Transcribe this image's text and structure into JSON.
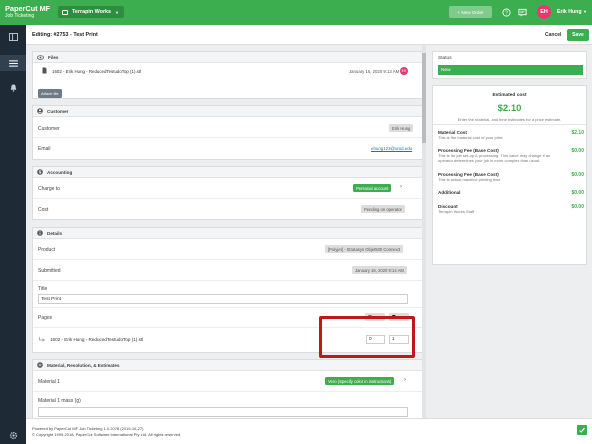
{
  "topbar": {
    "brand_title": "PaperCut MF",
    "brand_sub": "Job Ticketing",
    "org_name": "Terrapin Works",
    "new_order_label": "+ New Order",
    "user_initials": "EH",
    "user_name": "Erik Hung",
    "accent": "#3dae4f"
  },
  "editing": {
    "title": "Editing: #2753  -  Test Print",
    "cancel_label": "Cancel",
    "save_label": "Save"
  },
  "files": {
    "heading": "Files",
    "file_name": "1602 - Erik Hung - ReducedTestudoTop (1).stl",
    "file_date": "January 16, 2020 9:13 AM",
    "file_avatar": "EH",
    "attach_label": "Attach file"
  },
  "customer": {
    "heading": "Customer",
    "customer_label": "Customer",
    "customer_value": "Erik Hung",
    "email_label": "Email",
    "email_value": "ehung123@umd.edu"
  },
  "accounting": {
    "heading": "Accounting",
    "charge_label": "Charge to",
    "charge_value": "Personal account",
    "cost_label": "Cost",
    "cost_value": "Pending on operator"
  },
  "details": {
    "heading": "Details",
    "product_label": "Product",
    "product_value": "[Polyjet] - Stratasys Objet500 Connex3",
    "submitted_label": "Submitted",
    "submitted_value": "January 16, 2020 9:14 AM",
    "title_label": "Title",
    "title_value": "Test Print",
    "pages_label": "Pages",
    "pages_count_a": "0",
    "pages_count_b": "1",
    "file_row_name": "1602 - Erik Hung - ReducedTestudoTop (1).stl",
    "file_row_a": "0",
    "file_row_b": "1"
  },
  "material": {
    "heading": "Material, Resolution, & Estimates",
    "material_label": "Material 1",
    "material_value": "Vero (Specify color in instructions)",
    "mass_label": "Material 1 mass (g)"
  },
  "status": {
    "heading": "Status",
    "value": "New"
  },
  "estimate": {
    "heading": "Estimated cost",
    "amount": "$2.10",
    "hint": "Enter the material, and time estimates for a price estimate.",
    "lines": [
      {
        "title": "Material Cost",
        "desc": "This is the material cost of your print.",
        "value": "$2.10"
      },
      {
        "title": "Processing Fee (Base Cost)",
        "desc": "This is for job set-up & processing. This value may change if an operator determines your job is more complex than usual.",
        "value": "$0.00"
      },
      {
        "title": "Processing Fee (Base Cost)",
        "desc": "This is actual machine printing time",
        "value": "$0.00"
      },
      {
        "title": "Additional",
        "desc": "",
        "value": "$0.00"
      },
      {
        "title": "Discount",
        "desc": "Terrapin Works Staff",
        "value": "$0.00"
      }
    ]
  },
  "footer": {
    "line1": "Powered by PaperCut MF Job Ticketing 1.0.2076 (2019-10-27)",
    "line2": "© Copyright 1999-2018, PaperCut Software International Pty Ltd. All rights reserved."
  }
}
